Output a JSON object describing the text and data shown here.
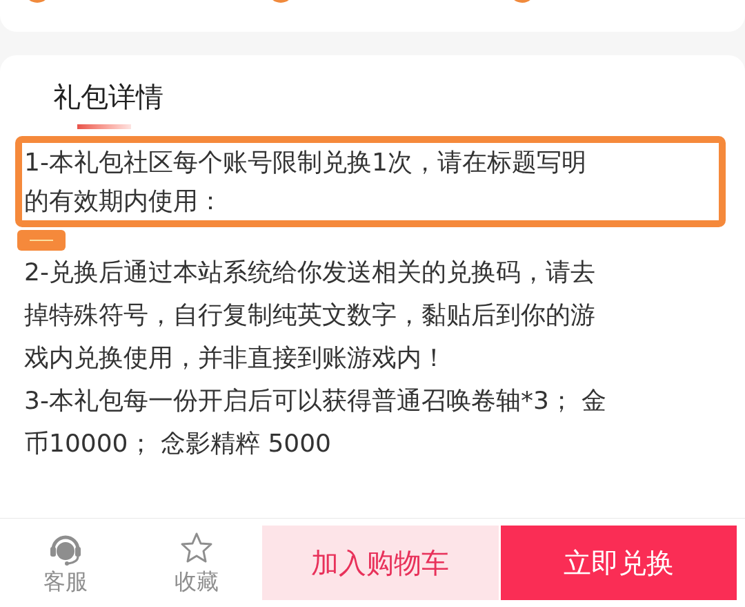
{
  "section": {
    "title": "礼包详情"
  },
  "details": [
    [
      "1-本礼包社区每个账号限制兑换1次，请在标题写明",
      "的有效期内使用："
    ],
    [
      "2-兑换后通过本站系统给你发送相关的兑换码，请去",
      "掉特殊符号，自行复制纯英文数字，黏贴后到你的游",
      "戏内兑换使用，并非直接到账游戏内！"
    ],
    [
      "3-本礼包每一份开启后可以获得普通召唤卷轴*3； 金",
      "币10000； 念影精粹 5000"
    ]
  ],
  "bottom_bar": {
    "actions": [
      {
        "kind": "service",
        "label": "客服"
      },
      {
        "kind": "favorite",
        "label": "收藏"
      }
    ],
    "buttons": [
      {
        "kind": "cart",
        "label": "加入购物车"
      },
      {
        "kind": "exchange",
        "label": "立即兑换"
      }
    ]
  }
}
